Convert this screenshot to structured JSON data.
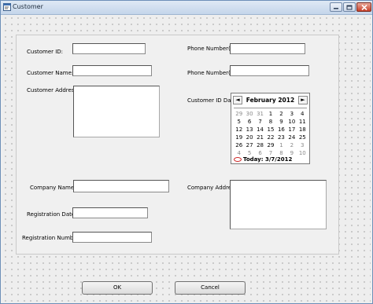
{
  "window": {
    "title": "Customer"
  },
  "form": {
    "customer_id_label": "Customer ID:",
    "customer_id_value": "",
    "customer_name_label": "Customer Name:",
    "customer_name_value": "",
    "customer_address_label": "Customer Address:",
    "customer_address_value": "",
    "company_name_label": "Company Name:",
    "company_name_value": "",
    "registration_date_label": "Registration Date:",
    "registration_date_value": "",
    "registration_number_label": "Registration Number:",
    "registration_number_value": "",
    "phone_r_label": "Phone Number(R):",
    "phone_r_value": "",
    "phone_m_label": "Phone Number(M):",
    "phone_m_value": "",
    "customer_id_date_label": "Customer ID Date:",
    "company_address_label": "Company Address:",
    "company_address_value": ""
  },
  "calendar": {
    "month_title": "February 2012",
    "prev_symbol": "◄",
    "next_symbol": "►",
    "today_label": "Today: 3/7/2012",
    "days": [
      {
        "d": "29",
        "other": true
      },
      {
        "d": "30",
        "other": true
      },
      {
        "d": "31",
        "other": true
      },
      {
        "d": "1"
      },
      {
        "d": "2"
      },
      {
        "d": "3"
      },
      {
        "d": "4"
      },
      {
        "d": "5"
      },
      {
        "d": "6"
      },
      {
        "d": "7"
      },
      {
        "d": "8"
      },
      {
        "d": "9"
      },
      {
        "d": "10"
      },
      {
        "d": "11"
      },
      {
        "d": "12"
      },
      {
        "d": "13"
      },
      {
        "d": "14"
      },
      {
        "d": "15"
      },
      {
        "d": "16"
      },
      {
        "d": "17"
      },
      {
        "d": "18"
      },
      {
        "d": "19"
      },
      {
        "d": "20"
      },
      {
        "d": "21"
      },
      {
        "d": "22"
      },
      {
        "d": "23"
      },
      {
        "d": "24"
      },
      {
        "d": "25"
      },
      {
        "d": "26"
      },
      {
        "d": "27"
      },
      {
        "d": "28"
      },
      {
        "d": "29"
      },
      {
        "d": "1",
        "other": true
      },
      {
        "d": "2",
        "other": true
      },
      {
        "d": "3",
        "other": true
      },
      {
        "d": "4",
        "other": true
      },
      {
        "d": "5",
        "other": true
      },
      {
        "d": "6",
        "other": true
      },
      {
        "d": "7",
        "other": true
      },
      {
        "d": "8",
        "other": true
      },
      {
        "d": "9",
        "other": true
      },
      {
        "d": "10",
        "other": true
      }
    ]
  },
  "buttons": {
    "ok": "OK",
    "cancel": "Cancel"
  },
  "icons": {
    "app": "form-icon",
    "minimize": "minimize-icon",
    "maximize": "maximize-icon",
    "close": "close-icon"
  }
}
